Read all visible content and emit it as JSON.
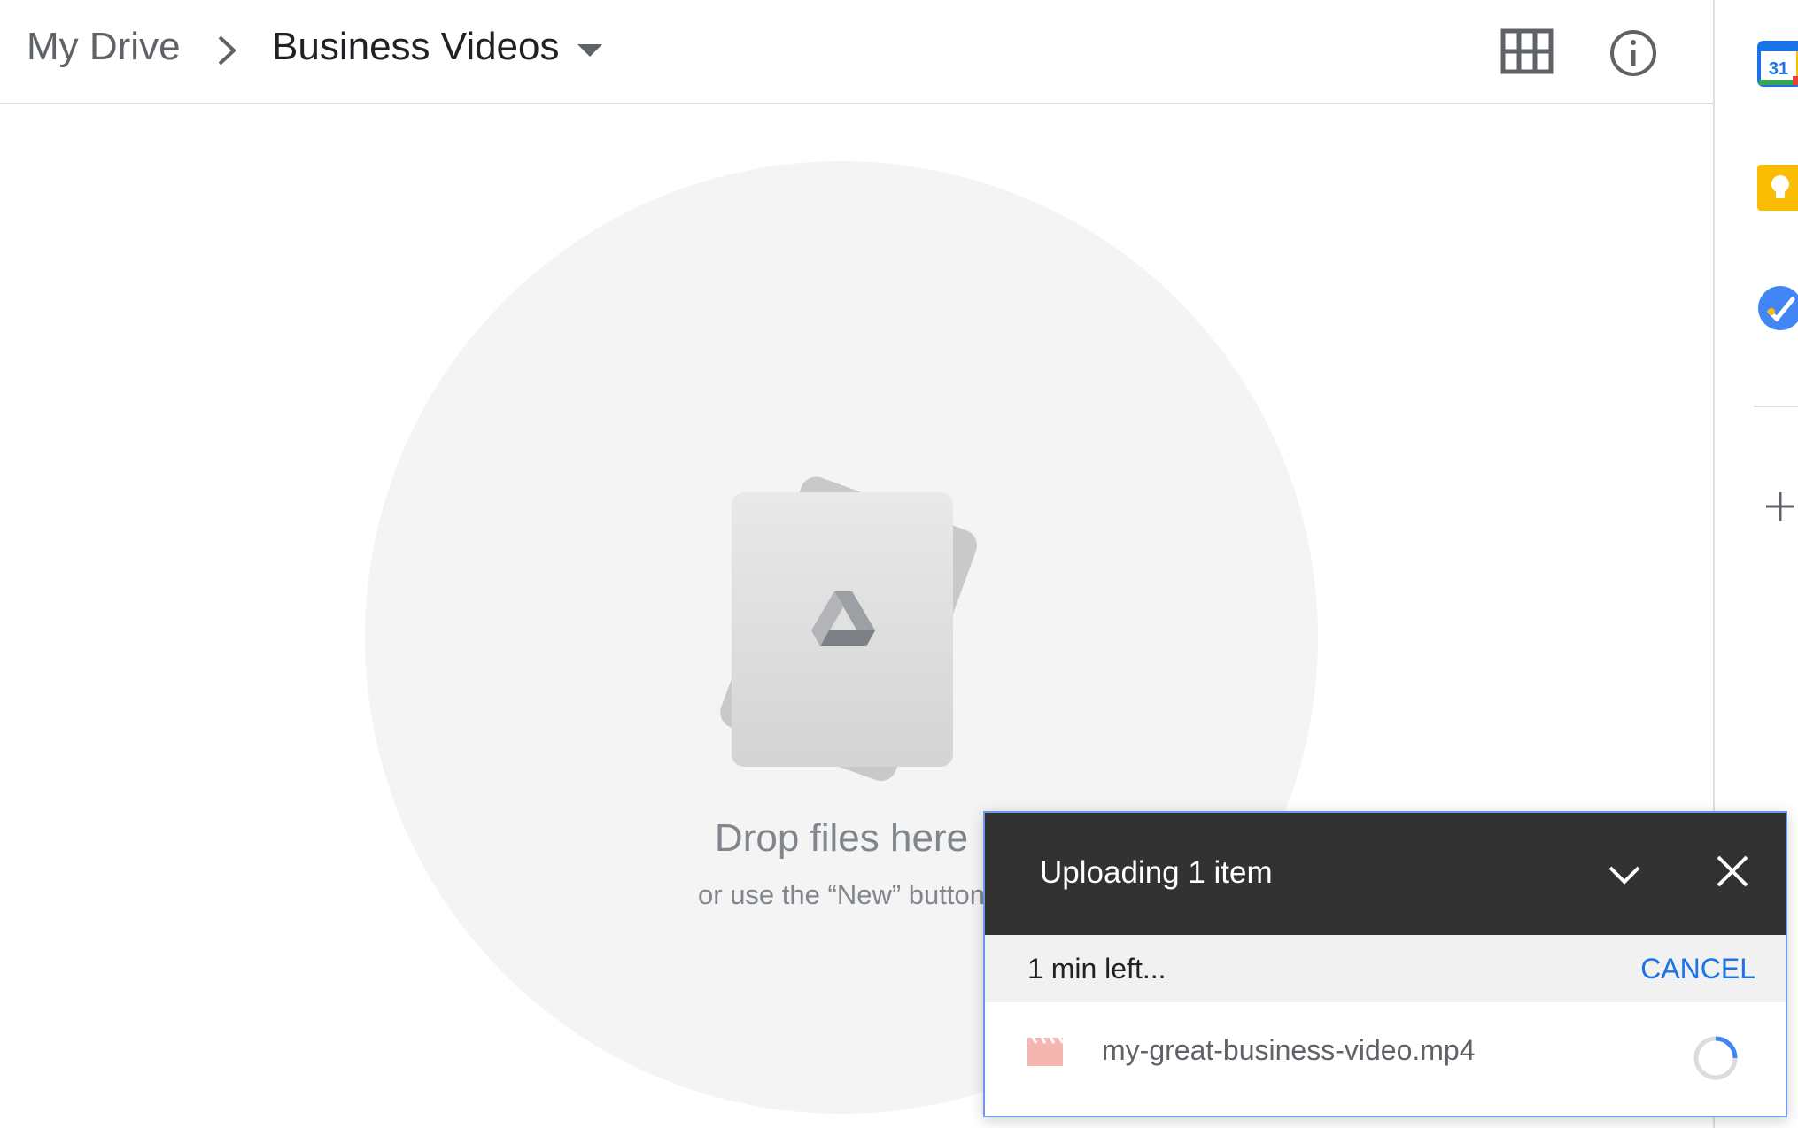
{
  "header": {
    "breadcrumb_root": "My Drive",
    "breadcrumb_current": "Business Videos"
  },
  "side_panel": {
    "apps": [
      {
        "name": "calendar-icon",
        "label": "31",
        "color": "#1a73e8"
      },
      {
        "name": "keep-icon",
        "color": "#fbbc04"
      },
      {
        "name": "tasks-icon",
        "color": "#4285f4"
      }
    ]
  },
  "empty_state": {
    "title": "Drop files here",
    "subtitle": "or use the “New” button"
  },
  "upload": {
    "title": "Uploading 1 item",
    "time_left": "1 min left...",
    "cancel_label": "CANCEL",
    "file": {
      "name": "my-great-business-video.mp4",
      "type_icon": "video-file-icon"
    }
  },
  "colors": {
    "accent": "#1a73e8",
    "upload_header_bg": "#323232",
    "video_icon": "#f4b6b0"
  }
}
